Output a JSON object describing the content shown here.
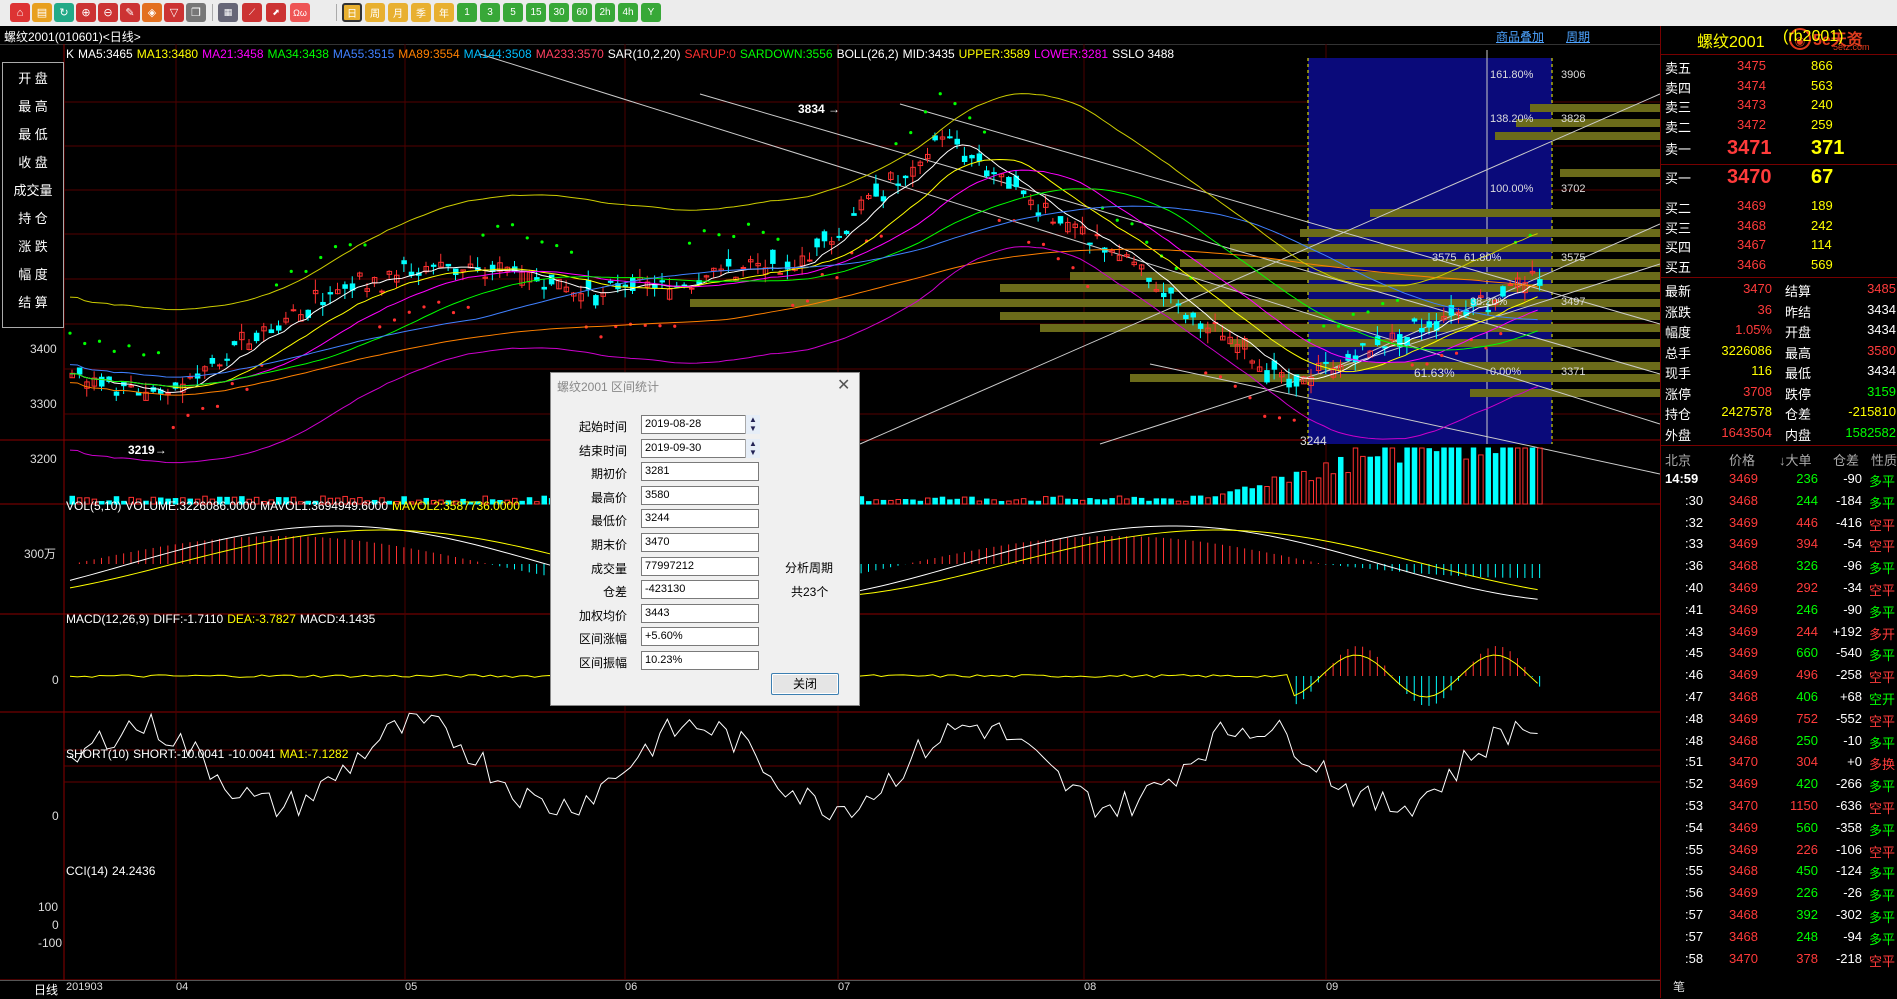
{
  "toolbar": {
    "icons": [
      "home-icon",
      "folder-icon",
      "refresh-icon",
      "zoom-in-icon",
      "zoom-out-icon",
      "pen-icon",
      "paint-icon",
      "funnel-icon",
      "copy-icon",
      "table-icon",
      "line-chart-icon",
      "stock-icon",
      "split-icon",
      "day-icon",
      "week-icon",
      "month-icon",
      "quarter-icon",
      "year-icon",
      "1min-icon",
      "3min-icon",
      "5min-icon",
      "15min-icon",
      "30min-icon",
      "60min-icon",
      "2h-icon",
      "4h-icon",
      "tick-icon"
    ],
    "labels": [
      "日",
      "周",
      "月",
      "季",
      "年",
      "1",
      "3",
      "5",
      "15",
      "30",
      "60",
      "2h",
      "4h",
      "Y"
    ]
  },
  "title": {
    "text": "螺纹2001(010601)<日线>",
    "link1": "商品叠加",
    "link2": "周期"
  },
  "indicator_lines": {
    "main": [
      {
        "text": "K",
        "color": "#ffffff"
      },
      {
        "text": "MA5:3465",
        "color": "#ffffff"
      },
      {
        "text": "MA13:3480",
        "color": "#ffff00"
      },
      {
        "text": "MA21:3458",
        "color": "#ff00ff"
      },
      {
        "text": "MA34:3438",
        "color": "#00ff00"
      },
      {
        "text": "MA55:3515",
        "color": "#4080ff"
      },
      {
        "text": "MA89:3554",
        "color": "#ff8000"
      },
      {
        "text": "MA144:3508",
        "color": "#00bfff"
      },
      {
        "text": "MA233:3570",
        "color": "#ff4060"
      },
      {
        "text": "SAR(10,2,20)",
        "color": "#ffffff"
      },
      {
        "text": "SARUP:0",
        "color": "#ff3030"
      },
      {
        "text": "SARDOWN:3556",
        "color": "#00ff00"
      },
      {
        "text": "BOLL(26,2)",
        "color": "#ffffff"
      },
      {
        "text": "MID:3435",
        "color": "#ffffff"
      },
      {
        "text": "UPPER:3589",
        "color": "#ffff00"
      },
      {
        "text": "LOWER:3281",
        "color": "#ff00ff"
      },
      {
        "text": "SSLO 3488",
        "color": "#ffffff"
      }
    ],
    "vol": [
      {
        "text": "VOL(5,10)",
        "color": "#ffffff"
      },
      {
        "text": "VOLUME:3226086.0000",
        "color": "#ffffff"
      },
      {
        "text": "MAVOL1:3694949.6000",
        "color": "#ffffff"
      },
      {
        "text": "MAVOL2:3587736.0000",
        "color": "#ffff00"
      }
    ],
    "macd": [
      {
        "text": "MACD(12,26,9)",
        "color": "#ffffff"
      },
      {
        "text": "DIFF:-1.7110",
        "color": "#ffffff"
      },
      {
        "text": "DEA:-3.7827",
        "color": "#ffff00"
      },
      {
        "text": "MACD:4.1435",
        "color": "#ffffff"
      }
    ],
    "short": [
      {
        "text": "SHORT(10)",
        "color": "#ffffff"
      },
      {
        "text": "SHORT:-10.0041",
        "color": "#ffffff"
      },
      {
        "text": "-10.0041",
        "color": "#ffffff"
      },
      {
        "text": "MA1:-7.1282",
        "color": "#ffff00"
      }
    ],
    "cci": [
      {
        "text": "CCI(14)",
        "color": "#ffffff"
      },
      {
        "text": "24.2436",
        "color": "#ffffff"
      }
    ]
  },
  "left_panel": [
    "开 盘",
    "最 高",
    "最 低",
    "收 盘",
    "成交量",
    "持 仓",
    "涨 跌",
    "幅 度",
    "结 算"
  ],
  "y_axis_main": [
    "3400",
    "3300",
    "3200"
  ],
  "y_axis_vol": [
    "300万"
  ],
  "y_axis_macd": [
    "0"
  ],
  "y_axis_short": [
    "0"
  ],
  "y_axis_cci": [
    "100",
    "0",
    "-100"
  ],
  "x_axis": {
    "corner": "日线",
    "labels": [
      "201903",
      "04",
      "05",
      "06",
      "07",
      "08",
      "09"
    ]
  },
  "annotations": {
    "high": "3834",
    "low_left": "3219",
    "low_right": "3244",
    "mid": "3575",
    "fib_low": "61.63%"
  },
  "fib_levels": [
    {
      "pct": "161.80%",
      "price": "3906"
    },
    {
      "pct": "138.20%",
      "price": "3828"
    },
    {
      "pct": "100.00%",
      "price": "3702"
    },
    {
      "pct": "61.80%",
      "price": "3575"
    },
    {
      "pct": "38.20%",
      "price": "3497"
    },
    {
      "pct": "0.00%",
      "price": "3371"
    }
  ],
  "dialog": {
    "title": "螺纹2001 区间统计",
    "fields": [
      {
        "label": "起始时间",
        "value": "2019-08-28",
        "spin": true
      },
      {
        "label": "结束时间",
        "value": "2019-09-30",
        "spin": true
      },
      {
        "label": "期初价",
        "value": "3281"
      },
      {
        "label": "最高价",
        "value": "3580"
      },
      {
        "label": "最低价",
        "value": "3244"
      },
      {
        "label": "期末价",
        "value": "3470"
      },
      {
        "label": "成交量",
        "value": "77997212"
      },
      {
        "label": "仓差",
        "value": "-423130"
      },
      {
        "label": "加权均价",
        "value": "3443"
      },
      {
        "label": "区间涨幅",
        "value": "+5.60%"
      },
      {
        "label": "区间振幅",
        "value": "10.23%"
      }
    ],
    "period_label": "分析周期",
    "period_value": "共23个",
    "close_button": "关闭"
  },
  "quote": {
    "name": "螺纹2001",
    "code": "(rb2001)",
    "logo": "5e天资",
    "logo_sub": "5etz.com",
    "asks": [
      {
        "label": "卖五",
        "price": "3475",
        "vol": "866"
      },
      {
        "label": "卖四",
        "price": "3474",
        "vol": "563"
      },
      {
        "label": "卖三",
        "price": "3473",
        "vol": "240"
      },
      {
        "label": "卖二",
        "price": "3472",
        "vol": "259"
      }
    ],
    "ask1": {
      "label": "卖一",
      "price": "3471",
      "vol": "371"
    },
    "bid1": {
      "label": "买一",
      "price": "3470",
      "vol": "67"
    },
    "bids": [
      {
        "label": "买二",
        "price": "3469",
        "vol": "189"
      },
      {
        "label": "买三",
        "price": "3468",
        "vol": "242"
      },
      {
        "label": "买四",
        "price": "3467",
        "vol": "114"
      },
      {
        "label": "买五",
        "price": "3466",
        "vol": "569"
      }
    ],
    "stats": [
      {
        "l1": "最新",
        "v1": "3470",
        "c1": "red",
        "l2": "结算",
        "v2": "3485",
        "c2": "red"
      },
      {
        "l1": "涨跌",
        "v1": "36",
        "c1": "red",
        "l2": "昨结",
        "v2": "3434",
        "c2": "wht"
      },
      {
        "l1": "幅度",
        "v1": "1.05%",
        "c1": "red",
        "l2": "开盘",
        "v2": "3434",
        "c2": "wht"
      },
      {
        "l1": "总手",
        "v1": "3226086",
        "c1": "yel",
        "l2": "最高",
        "v2": "3580",
        "c2": "red"
      },
      {
        "l1": "现手",
        "v1": "116",
        "c1": "yel",
        "l2": "最低",
        "v2": "3434",
        "c2": "wht"
      },
      {
        "l1": "涨停",
        "v1": "3708",
        "c1": "red",
        "l2": "跌停",
        "v2": "3159",
        "c2": "grn"
      },
      {
        "l1": "持仓",
        "v1": "2427578",
        "c1": "yel",
        "l2": "仓差",
        "v2": "-215810",
        "c2": "yel"
      },
      {
        "l1": "外盘",
        "v1": "1643504",
        "c1": "red",
        "l2": "内盘",
        "v2": "1582582",
        "c2": "grn"
      }
    ],
    "ticks_header": {
      "c0": "北京",
      "c1": "价格",
      "c2": "↓大单",
      "c3": "仓差",
      "c4": "性质"
    },
    "ticks": [
      {
        "t": "14:59",
        "p": "3469",
        "v": "236",
        "d": "-90",
        "n": "多平",
        "pc": "red",
        "vc": "grn",
        "nc": "grn"
      },
      {
        "t": ":30",
        "p": "3468",
        "v": "244",
        "d": "-184",
        "n": "多平",
        "pc": "red",
        "vc": "grn",
        "nc": "grn"
      },
      {
        "t": ":32",
        "p": "3469",
        "v": "446",
        "d": "-416",
        "n": "空平",
        "pc": "red",
        "vc": "red",
        "nc": "red"
      },
      {
        "t": ":33",
        "p": "3469",
        "v": "394",
        "d": "-54",
        "n": "空平",
        "pc": "red",
        "vc": "red",
        "nc": "red"
      },
      {
        "t": ":36",
        "p": "3468",
        "v": "326",
        "d": "-96",
        "n": "多平",
        "pc": "red",
        "vc": "grn",
        "nc": "grn"
      },
      {
        "t": ":40",
        "p": "3469",
        "v": "292",
        "d": "-34",
        "n": "空平",
        "pc": "red",
        "vc": "red",
        "nc": "red"
      },
      {
        "t": ":41",
        "p": "3469",
        "v": "246",
        "d": "-90",
        "n": "多平",
        "pc": "red",
        "vc": "grn",
        "nc": "grn"
      },
      {
        "t": ":43",
        "p": "3469",
        "v": "244",
        "d": "+192",
        "n": "多开",
        "pc": "red",
        "vc": "red",
        "nc": "red"
      },
      {
        "t": ":45",
        "p": "3469",
        "v": "660",
        "d": "-540",
        "n": "多平",
        "pc": "red",
        "vc": "grn",
        "nc": "grn"
      },
      {
        "t": ":46",
        "p": "3469",
        "v": "496",
        "d": "-258",
        "n": "空平",
        "pc": "red",
        "vc": "red",
        "nc": "red"
      },
      {
        "t": ":47",
        "p": "3468",
        "v": "406",
        "d": "+68",
        "n": "空开",
        "pc": "red",
        "vc": "grn",
        "nc": "grn"
      },
      {
        "t": ":48",
        "p": "3469",
        "v": "752",
        "d": "-552",
        "n": "空平",
        "pc": "red",
        "vc": "red",
        "nc": "red"
      },
      {
        "t": ":48",
        "p": "3468",
        "v": "250",
        "d": "-10",
        "n": "多平",
        "pc": "red",
        "vc": "grn",
        "nc": "grn"
      },
      {
        "t": ":51",
        "p": "3470",
        "v": "304",
        "d": "+0",
        "n": "多换",
        "pc": "red",
        "vc": "red",
        "nc": "red"
      },
      {
        "t": ":52",
        "p": "3469",
        "v": "420",
        "d": "-266",
        "n": "多平",
        "pc": "red",
        "vc": "grn",
        "nc": "grn"
      },
      {
        "t": ":53",
        "p": "3470",
        "v": "1150",
        "d": "-636",
        "n": "空平",
        "pc": "red",
        "vc": "red",
        "nc": "red"
      },
      {
        "t": ":54",
        "p": "3469",
        "v": "560",
        "d": "-358",
        "n": "多平",
        "pc": "red",
        "vc": "grn",
        "nc": "grn"
      },
      {
        "t": ":55",
        "p": "3469",
        "v": "226",
        "d": "-106",
        "n": "空平",
        "pc": "red",
        "vc": "red",
        "nc": "red"
      },
      {
        "t": ":55",
        "p": "3468",
        "v": "450",
        "d": "-124",
        "n": "多平",
        "pc": "red",
        "vc": "grn",
        "nc": "grn"
      },
      {
        "t": ":56",
        "p": "3469",
        "v": "226",
        "d": "-26",
        "n": "多平",
        "pc": "red",
        "vc": "grn",
        "nc": "grn"
      },
      {
        "t": ":57",
        "p": "3468",
        "v": "392",
        "d": "-302",
        "n": "多平",
        "pc": "red",
        "vc": "grn",
        "nc": "grn"
      },
      {
        "t": ":57",
        "p": "3468",
        "v": "248",
        "d": "-94",
        "n": "多平",
        "pc": "red",
        "vc": "grn",
        "nc": "grn"
      },
      {
        "t": ":58",
        "p": "3470",
        "v": "378",
        "d": "-218",
        "n": "空平",
        "pc": "red",
        "vc": "red",
        "nc": "red"
      }
    ],
    "bottom_tab": "笔"
  }
}
